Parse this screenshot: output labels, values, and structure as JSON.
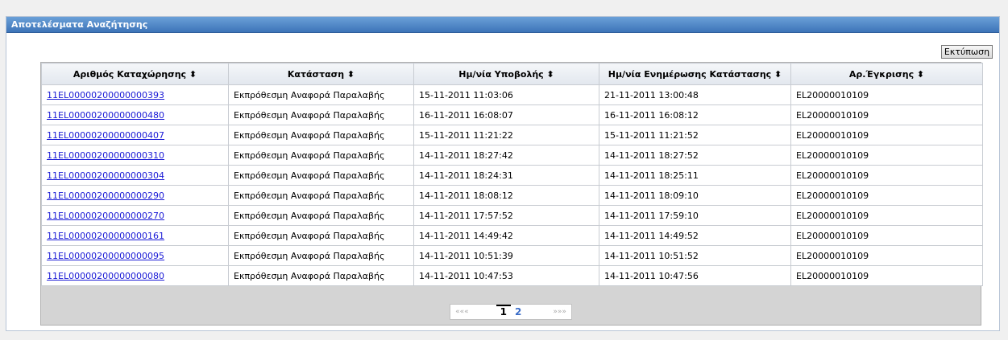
{
  "panel": {
    "title": "Αποτελέσματα Αναζήτησης"
  },
  "toolbar": {
    "print_label": "Εκτύπωση"
  },
  "table": {
    "columns": [
      "Αριθμός Καταχώρησης ⬍",
      "Κατάσταση ⬍",
      "Ημ/νία Υποβολής ⬍",
      "Ημ/νία Ενημέρωσης Κατάστασης ⬍",
      "Αρ.Έγκρισης ⬍"
    ],
    "rows": [
      [
        "11EL00000200000000393",
        "Εκπρόθεσμη Αναφορά Παραλαβής",
        "15-11-2011 11:03:06",
        "21-11-2011 13:00:48",
        "EL20000010109"
      ],
      [
        "11EL00000200000000480",
        "Εκπρόθεσμη Αναφορά Παραλαβής",
        "16-11-2011 16:08:07",
        "16-11-2011 16:08:12",
        "EL20000010109"
      ],
      [
        "11EL00000200000000407",
        "Εκπρόθεσμη Αναφορά Παραλαβής",
        "15-11-2011 11:21:22",
        "15-11-2011 11:21:52",
        "EL20000010109"
      ],
      [
        "11EL00000200000000310",
        "Εκπρόθεσμη Αναφορά Παραλαβής",
        "14-11-2011 18:27:42",
        "14-11-2011 18:27:52",
        "EL20000010109"
      ],
      [
        "11EL00000200000000304",
        "Εκπρόθεσμη Αναφορά Παραλαβής",
        "14-11-2011 18:24:31",
        "14-11-2011 18:25:11",
        "EL20000010109"
      ],
      [
        "11EL00000200000000290",
        "Εκπρόθεσμη Αναφορά Παραλαβής",
        "14-11-2011 18:08:12",
        "14-11-2011 18:09:10",
        "EL20000010109"
      ],
      [
        "11EL00000200000000270",
        "Εκπρόθεσμη Αναφορά Παραλαβής",
        "14-11-2011 17:57:52",
        "14-11-2011 17:59:10",
        "EL20000010109"
      ],
      [
        "11EL00000200000000161",
        "Εκπρόθεσμη Αναφορά Παραλαβής",
        "14-11-2011 14:49:42",
        "14-11-2011 14:49:52",
        "EL20000010109"
      ],
      [
        "11EL00000200000000095",
        "Εκπρόθεσμη Αναφορά Παραλαβής",
        "14-11-2011 10:51:39",
        "14-11-2011 10:51:52",
        "EL20000010109"
      ],
      [
        "11EL00000200000000080",
        "Εκπρόθεσμη Αναφορά Παραλαβής",
        "14-11-2011 10:47:53",
        "14-11-2011 10:47:56",
        "EL20000010109"
      ]
    ]
  },
  "pager": {
    "first_label": "«««",
    "last_label": "»»»",
    "pages": [
      "1",
      "2"
    ],
    "current_page": "1"
  }
}
